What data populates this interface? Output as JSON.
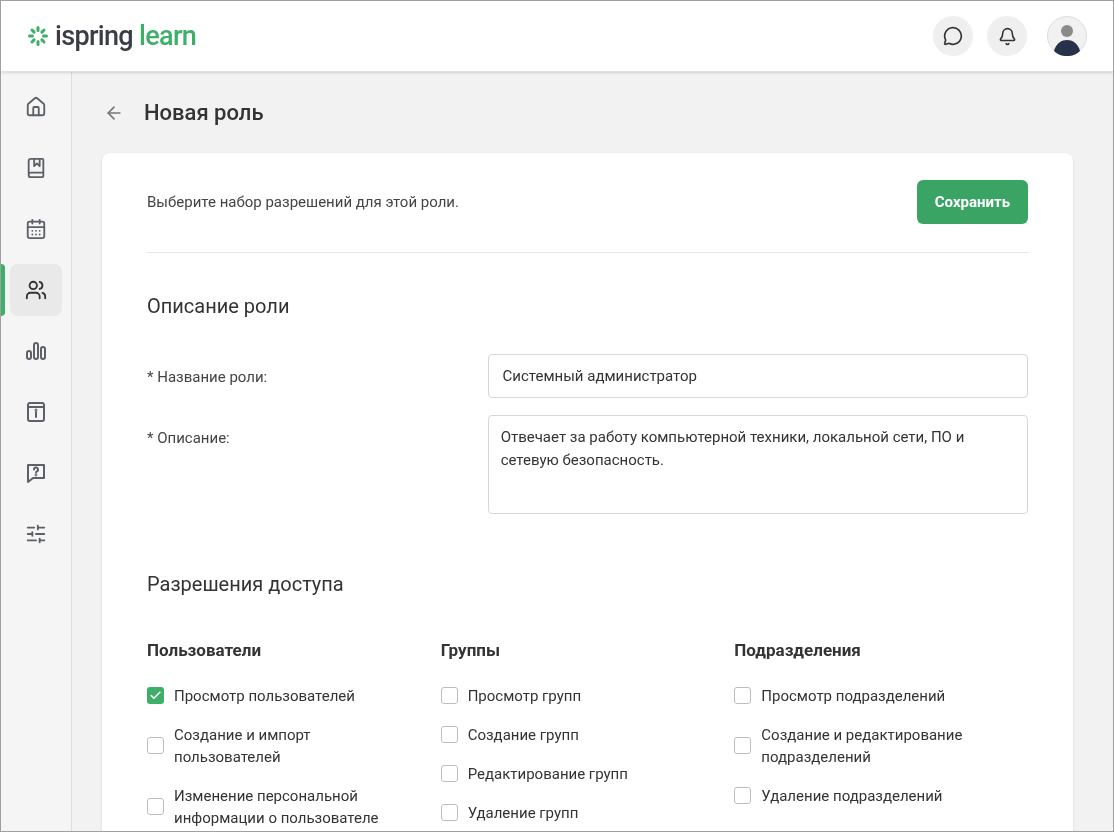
{
  "header": {
    "logo": {
      "brand": "ispring",
      "product": "learn"
    }
  },
  "sidebar": {
    "items": [
      {
        "selected": false
      },
      {
        "selected": false
      },
      {
        "selected": false
      },
      {
        "selected": true
      },
      {
        "selected": false
      },
      {
        "selected": false
      },
      {
        "selected": false
      },
      {
        "selected": false
      }
    ]
  },
  "page": {
    "title": "Новая роль"
  },
  "card": {
    "intro": "Выберите набор разрешений для этой роли.",
    "save_button": "Сохранить",
    "description_section": {
      "title": "Описание роли",
      "fields": [
        {
          "kind": "input",
          "label": "* Название роли:",
          "value": "Системный администратор"
        },
        {
          "kind": "textarea",
          "label": "* Описание:",
          "value": "Отвечает за работу компьютерной техники, локальной сети, ПО и сетевую безопасность."
        }
      ]
    },
    "permissions_section": {
      "title": "Разрешения доступа",
      "groups": [
        {
          "title": "Пользователи",
          "items": [
            {
              "label": "Просмотр пользователей",
              "checked": true
            },
            {
              "label": "Создание и импорт пользователей",
              "checked": false
            },
            {
              "label": "Изменение персональной информации о пользователе",
              "checked": false
            }
          ]
        },
        {
          "title": "Группы",
          "items": [
            {
              "label": "Просмотр групп",
              "checked": false
            },
            {
              "label": "Создание групп",
              "checked": false
            },
            {
              "label": "Редактирование групп",
              "checked": false
            },
            {
              "label": "Удаление групп",
              "checked": false
            }
          ]
        },
        {
          "title": "Подразделения",
          "items": [
            {
              "label": "Просмотр подразделений",
              "checked": false
            },
            {
              "label": "Создание и редактирование подразделений",
              "checked": false
            },
            {
              "label": "Удаление подразделений",
              "checked": false
            }
          ]
        }
      ]
    }
  }
}
